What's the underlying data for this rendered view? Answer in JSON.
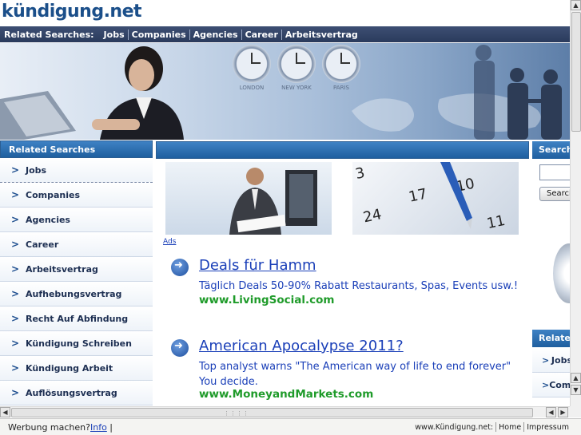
{
  "site": {
    "title": "kündigung.net"
  },
  "topnav": {
    "label": "Related Searches:",
    "links": [
      "Jobs",
      "Companies",
      "Agencies",
      "Career",
      "Arbeitsvertrag"
    ]
  },
  "banner": {
    "clock_labels": [
      "LONDON",
      "NEW YORK",
      "PARIS"
    ]
  },
  "sidebar": {
    "heading": "Related Searches",
    "items": [
      "Jobs",
      "Companies",
      "Agencies",
      "Career",
      "Arbeitsvertrag",
      "Aufhebungsvertrag",
      "Recht Auf Abfindung",
      "Kündigung Schreiben",
      "Kündigung Arbeit",
      "Auflösungsvertrag"
    ]
  },
  "ads": {
    "label": "Ads",
    "items": [
      {
        "title": "Deals für Hamm",
        "desc": "Täglich Deals 50-90% Rabatt Restaurants, Spas, Events usw.!",
        "url": "www.LivingSocial.com"
      },
      {
        "title": "American Apocalypse 2011?",
        "desc": "Top analyst warns \"The American way of life to end forever\" You decide.",
        "url": "www.MoneyandMarkets.com"
      }
    ]
  },
  "right": {
    "search_heading": "Search",
    "search_button": "Search",
    "related_heading": "Related",
    "items": [
      "Jobs",
      "Companies"
    ]
  },
  "statusbar": {
    "left_text": "Werbung machen?",
    "info_link": "Info",
    "site": "www.Kündigung.net:",
    "home": "Home",
    "impressum": "Impressum"
  },
  "colors": {
    "header_blue": "#3f82c4",
    "title_blue": "#1b4f8a",
    "link_blue": "#1a3fb8",
    "url_green": "#1f9b2a"
  }
}
